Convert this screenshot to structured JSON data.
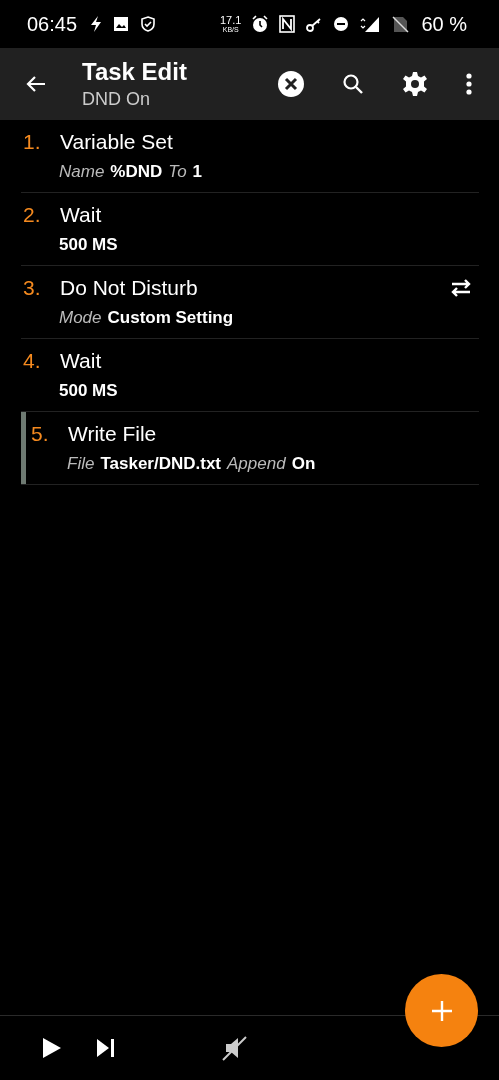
{
  "status_bar": {
    "time": "06:45",
    "net_speed": "17.1",
    "net_unit": "KB/S",
    "battery": "60 %"
  },
  "toolbar": {
    "title": "Task Edit",
    "subtitle": "DND On"
  },
  "actions": [
    {
      "number": "1.",
      "title": "Variable Set",
      "selected": false,
      "swap": false,
      "params": [
        {
          "label": "Name",
          "value": "%DND"
        },
        {
          "label": "To",
          "value": "1"
        }
      ]
    },
    {
      "number": "2.",
      "title": "Wait",
      "selected": false,
      "swap": false,
      "params": [
        {
          "value": "500 MS"
        }
      ]
    },
    {
      "number": "3.",
      "title": "Do Not Disturb",
      "selected": false,
      "swap": true,
      "params": [
        {
          "label": "Mode",
          "value": "Custom Setting"
        }
      ]
    },
    {
      "number": "4.",
      "title": "Wait",
      "selected": false,
      "swap": false,
      "params": [
        {
          "value": "500 MS"
        }
      ]
    },
    {
      "number": "5.",
      "title": "Write File",
      "selected": true,
      "swap": false,
      "params": [
        {
          "label": "File",
          "value": "Tasker/DND.txt"
        },
        {
          "label": "Append",
          "value": "On"
        }
      ]
    }
  ]
}
